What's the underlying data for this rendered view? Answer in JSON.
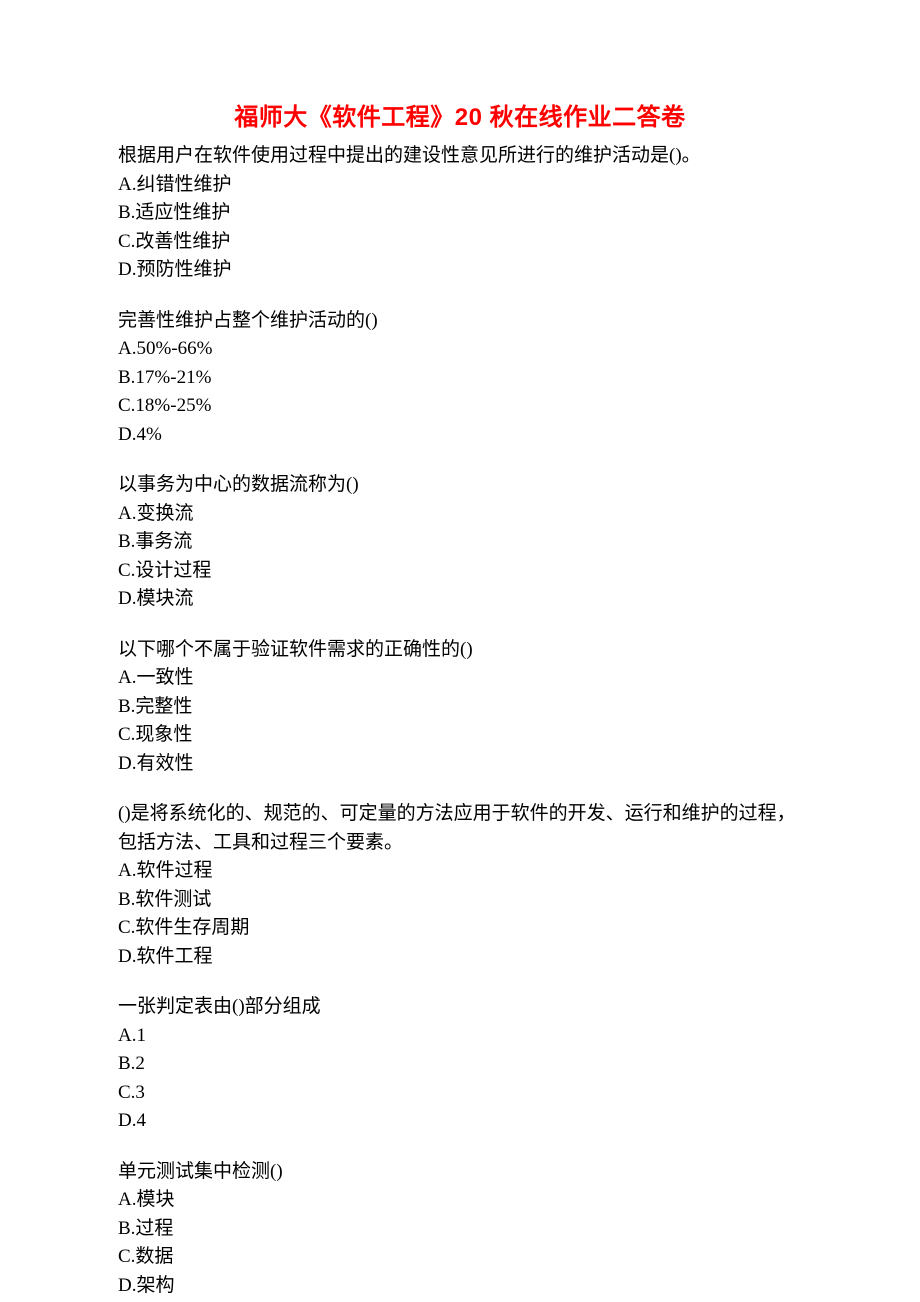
{
  "title": "福师大《软件工程》20 秋在线作业二答卷",
  "questions": [
    {
      "text": "根据用户在软件使用过程中提出的建设性意见所进行的维护活动是()。",
      "options": [
        "A.纠错性维护",
        "B.适应性维护",
        "C.改善性维护",
        "D.预防性维护"
      ]
    },
    {
      "text": "完善性维护占整个维护活动的()",
      "options": [
        "A.50%-66%",
        "B.17%-21%",
        "C.18%-25%",
        "D.4%"
      ]
    },
    {
      "text": "以事务为中心的数据流称为()",
      "options": [
        "A.变换流",
        "B.事务流",
        "C.设计过程",
        "D.模块流"
      ]
    },
    {
      "text": "以下哪个不属于验证软件需求的正确性的()",
      "options": [
        "A.一致性",
        "B.完整性",
        "C.现象性",
        "D.有效性"
      ]
    },
    {
      "text": "()是将系统化的、规范的、可定量的方法应用于软件的开发、运行和维护的过程，包括方法、工具和过程三个要素。",
      "options": [
        "A.软件过程",
        "B.软件测试",
        "C.软件生存周期",
        "D.软件工程"
      ]
    },
    {
      "text": "一张判定表由()部分组成",
      "options": [
        "A.1",
        "B.2",
        "C.3",
        "D.4"
      ]
    },
    {
      "text": "单元测试集中检测()",
      "options": [
        "A.模块",
        "B.过程",
        "C.数据",
        "D.架构"
      ]
    }
  ]
}
